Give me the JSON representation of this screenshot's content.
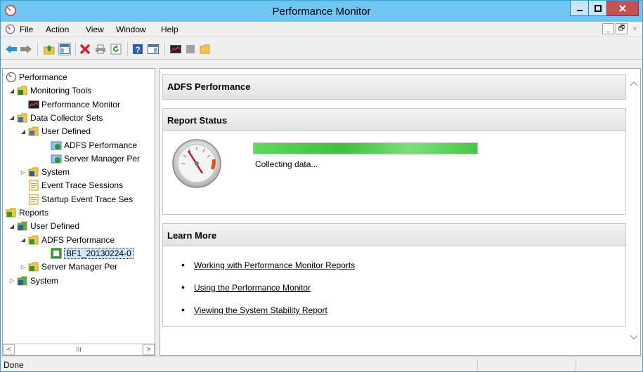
{
  "window": {
    "title": "Performance Monitor",
    "icons": {
      "app": "perfmon-icon",
      "minimize": "minimize-icon",
      "maximize": "maximize-icon",
      "close": "close-icon"
    }
  },
  "menu": {
    "items": [
      "File",
      "Action",
      "View",
      "Window",
      "Help"
    ],
    "mdi_buttons": [
      "_",
      "🗗",
      "×"
    ]
  },
  "toolbar": {
    "buttons": [
      "back-arrow-icon",
      "forward-arrow-icon",
      "up-folder-icon",
      "show-hide-tree-icon",
      "delete-icon",
      "print-icon",
      "refresh-icon",
      "help-icon",
      "show-hide-action-icon",
      "perfmon-icon",
      "stop-icon",
      "folder-icon"
    ]
  },
  "tree": {
    "nodes": [
      {
        "label": "Performance",
        "icon": "perfmon-icon",
        "expander": "",
        "level": 0
      },
      {
        "label": "Monitoring Tools",
        "icon": "folder-chart-icon",
        "expander": "◢",
        "level": 1
      },
      {
        "label": "Performance Monitor",
        "icon": "chart-icon",
        "expander": "",
        "level": 2
      },
      {
        "label": "Data Collector Sets",
        "icon": "folder-icon",
        "expander": "◢",
        "level": 1
      },
      {
        "label": "User Defined",
        "icon": "user-folder-icon",
        "expander": "◢",
        "level": 2
      },
      {
        "label": "ADFS Performance",
        "icon": "collector-set-icon",
        "expander": "",
        "level": 3
      },
      {
        "label": "Server Manager Per",
        "icon": "collector-set-icon",
        "expander": "",
        "level": 3
      },
      {
        "label": "System",
        "icon": "system-folder-icon",
        "expander": "▷",
        "level": 2
      },
      {
        "label": "Event Trace Sessions",
        "icon": "log-icon",
        "expander": "",
        "level": 2
      },
      {
        "label": "Startup Event Trace Ses",
        "icon": "log-icon",
        "expander": "",
        "level": 2
      },
      {
        "label": "Reports",
        "icon": "report-folder-icon",
        "expander": "◢",
        "level": 0
      },
      {
        "label": "User Defined",
        "icon": "user-report-icon",
        "expander": "◢",
        "level": 1
      },
      {
        "label": "ADFS Performance",
        "icon": "report-folder-icon",
        "expander": "◢",
        "level": 2
      },
      {
        "label": "BF1_20130224-0",
        "icon": "report-icon",
        "expander": "",
        "level": 3,
        "selected": true
      },
      {
        "label": "Server Manager Per",
        "icon": "report-folder-icon",
        "expander": "▷",
        "level": 2
      },
      {
        "label": "System",
        "icon": "system-report-icon",
        "expander": "▷",
        "level": 1
      }
    ],
    "scroll_thumb": "III"
  },
  "content": {
    "header_title": "ADFS Performance",
    "report_status": {
      "title": "Report Status",
      "progress": 1.0,
      "status_text": "Collecting data..."
    },
    "learn_more": {
      "title": "Learn More",
      "links": [
        "Working with Performance Monitor Reports",
        "Using the Performance Monitor",
        "Viewing the System Stability Report"
      ]
    }
  },
  "statusbar": {
    "text": "Done"
  },
  "colors": {
    "titlebar": "#6fc6f0",
    "close": "#c75050",
    "progress": "#3fbf3f",
    "selection": "#cde8ff"
  }
}
